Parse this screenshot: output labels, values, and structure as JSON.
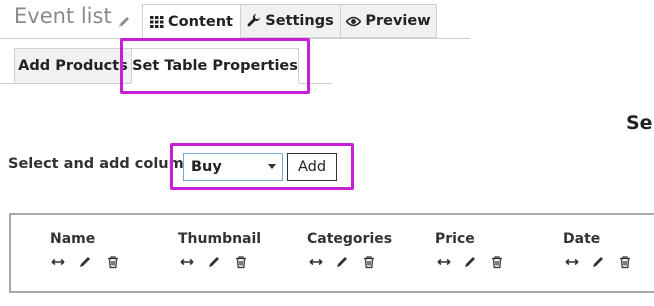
{
  "page": {
    "title": "Event list"
  },
  "top_tabs": [
    {
      "label": "Content",
      "icon": "grid-icon",
      "active": true
    },
    {
      "label": "Settings",
      "icon": "wrench-icon",
      "active": false
    },
    {
      "label": "Preview",
      "icon": "eye-icon",
      "active": false
    }
  ],
  "sub_tabs": [
    {
      "label": "Add Products",
      "active": false
    },
    {
      "label": "Set Table Properties",
      "active": true
    }
  ],
  "section_heading": "Sel",
  "columns_picker": {
    "label": "Select and add columns:",
    "selected": "Buy",
    "add_label": "Add"
  },
  "columns": [
    {
      "name": "Name"
    },
    {
      "name": "Thumbnail"
    },
    {
      "name": "Categories"
    },
    {
      "name": "Price"
    },
    {
      "name": "Date"
    }
  ],
  "colors": {
    "highlight": "#c81ed6",
    "select_border": "#7aa7d6",
    "tab_bg": "#f1f1f1"
  }
}
